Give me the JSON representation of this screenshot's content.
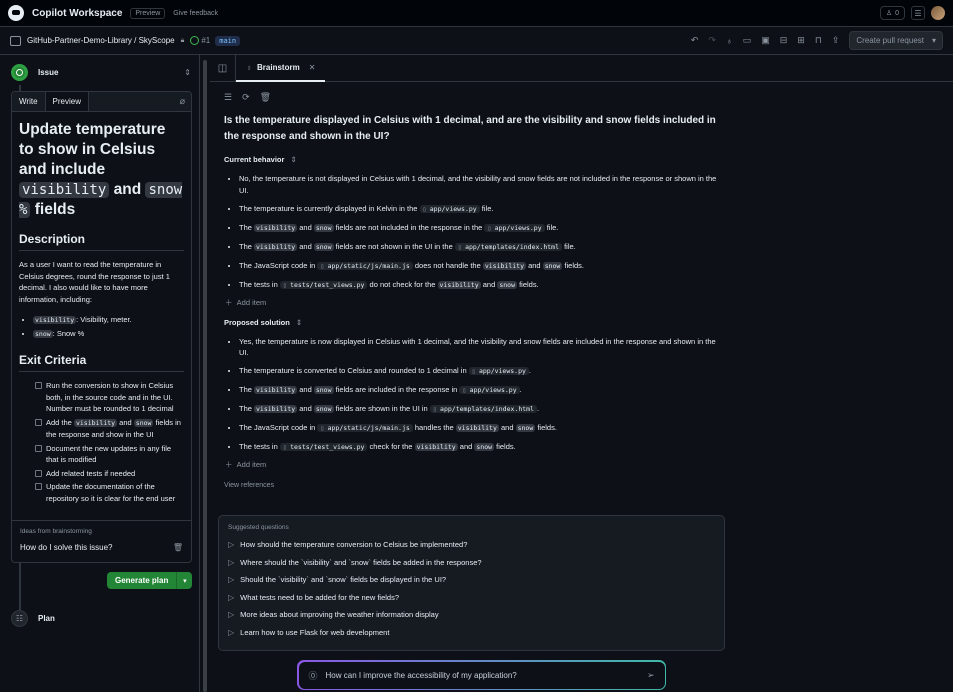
{
  "topbar": {
    "app_title": "Copilot Workspace",
    "preview_badge": "Preview",
    "feedback_link": "Give feedback",
    "notif_count": "0"
  },
  "repobar": {
    "repo": "GitHub-Partner-Demo-Library / SkyScope",
    "issue_number": "#1",
    "branch": "main",
    "create_pr": "Create pull request"
  },
  "sidebar": {
    "issue_label": "Issue",
    "tabs": [
      "Write",
      "Preview"
    ],
    "title_parts": [
      "Update temperature to show in Celsius and include ",
      "visibility",
      " and ",
      "snow %",
      " fields"
    ],
    "description_heading": "Description",
    "description": "As a user I want to read the temperature in Celsius degrees, round the response to just 1 decimal. I also would like to have more information, including:",
    "bullets": [
      {
        "code": "visibility",
        "text": ": Visibility, meter."
      },
      {
        "code": "snow",
        "text": ": Snow %"
      }
    ],
    "exit_heading": "Exit Criteria",
    "checklist": [
      [
        "Run the conversion to show in Celsius both, in the source code and in the UI. Number must be rounded to 1 decimal"
      ],
      [
        "Add the ",
        "visibility",
        " and ",
        "snow",
        " fields in the response and show in the UI"
      ],
      [
        "Document the new updates in any file that is modified"
      ],
      [
        "Add related tests if needed"
      ],
      [
        "Update the documentation of the repository so it is clear for the end user"
      ]
    ],
    "ideas_label": "Ideas from brainstorming",
    "idea": "How do I solve this issue?",
    "generate_plan": "Generate plan",
    "plan_label": "Plan"
  },
  "main": {
    "tab_label": "Brainstorm",
    "question": "Is the temperature displayed in Celsius with 1 decimal, and are the visibility and snow fields included in the response and shown in the UI?",
    "current_label": "Current behavior",
    "current": [
      [
        [
          "t",
          "No, the temperature is not displayed in Celsius with 1 decimal, and the visibility and snow fields are not included in the response or shown in the UI."
        ]
      ],
      [
        [
          "t",
          "The temperature is currently displayed in Kelvin in the "
        ],
        [
          "f",
          "app/views.py"
        ],
        [
          "t",
          " file."
        ]
      ],
      [
        [
          "t",
          "The "
        ],
        [
          "c",
          "visibility"
        ],
        [
          "t",
          " and "
        ],
        [
          "c",
          "snow"
        ],
        [
          "t",
          " fields are not included in the response in the "
        ],
        [
          "f",
          "app/views.py"
        ],
        [
          "t",
          " file."
        ]
      ],
      [
        [
          "t",
          "The "
        ],
        [
          "c",
          "visibility"
        ],
        [
          "t",
          " and "
        ],
        [
          "c",
          "snow"
        ],
        [
          "t",
          " fields are not shown in the UI in the "
        ],
        [
          "f",
          "app/templates/index.html"
        ],
        [
          "t",
          " file."
        ]
      ],
      [
        [
          "t",
          "The JavaScript code in "
        ],
        [
          "f",
          "app/static/js/main.js"
        ],
        [
          "t",
          " does not handle the "
        ],
        [
          "c",
          "visibility"
        ],
        [
          "t",
          " and "
        ],
        [
          "c",
          "snow"
        ],
        [
          "t",
          " fields."
        ]
      ],
      [
        [
          "t",
          "The tests in "
        ],
        [
          "f",
          "tests/test_views.py"
        ],
        [
          "t",
          " do not check for the "
        ],
        [
          "c",
          "visibility"
        ],
        [
          "t",
          " and "
        ],
        [
          "c",
          "snow"
        ],
        [
          "t",
          " fields."
        ]
      ]
    ],
    "add_item": "Add item",
    "proposed_label": "Proposed solution",
    "proposed": [
      [
        [
          "t",
          "Yes, the temperature is now displayed in Celsius with 1 decimal, and the visibility and snow fields are included in the response and shown in the UI."
        ]
      ],
      [
        [
          "t",
          "The temperature is converted to Celsius and rounded to 1 decimal in "
        ],
        [
          "f",
          "app/views.py"
        ],
        [
          "t",
          "."
        ]
      ],
      [
        [
          "t",
          "The "
        ],
        [
          "c",
          "visibility"
        ],
        [
          "t",
          " and "
        ],
        [
          "c",
          "snow"
        ],
        [
          "t",
          " fields are included in the response in "
        ],
        [
          "f",
          "app/views.py"
        ],
        [
          "t",
          "."
        ]
      ],
      [
        [
          "t",
          "The "
        ],
        [
          "c",
          "visibility"
        ],
        [
          "t",
          " and "
        ],
        [
          "c",
          "snow"
        ],
        [
          "t",
          " fields are shown in the UI in "
        ],
        [
          "f",
          "app/templates/index.html"
        ],
        [
          "t",
          "."
        ]
      ],
      [
        [
          "t",
          "The JavaScript code in "
        ],
        [
          "f",
          "app/static/js/main.js"
        ],
        [
          "t",
          " handles the "
        ],
        [
          "c",
          "visibility"
        ],
        [
          "t",
          " and "
        ],
        [
          "c",
          "snow"
        ],
        [
          "t",
          " fields."
        ]
      ],
      [
        [
          "t",
          "The tests in "
        ],
        [
          "f",
          "tests/test_views.py"
        ],
        [
          "t",
          " check for the "
        ],
        [
          "c",
          "visibility"
        ],
        [
          "t",
          " and "
        ],
        [
          "c",
          "snow"
        ],
        [
          "t",
          " fields."
        ]
      ]
    ],
    "view_refs": "View references",
    "suggested_label": "Suggested questions",
    "suggested": [
      "How should the temperature conversion to Celsius be implemented?",
      "Where should the `visibility` and `snow` fields be added in the response?",
      "Should the `visibility` and `snow` fields be displayed in the UI?",
      "What tests need to be added for the new fields?",
      "More ideas about improving the weather information display",
      "Learn how to use Flask for web development"
    ],
    "chat_value": "How can I improve the accessibility of my application?"
  },
  "colors": {
    "accent_green": "#238636",
    "bg": "#0d1117",
    "border": "#30363d"
  }
}
